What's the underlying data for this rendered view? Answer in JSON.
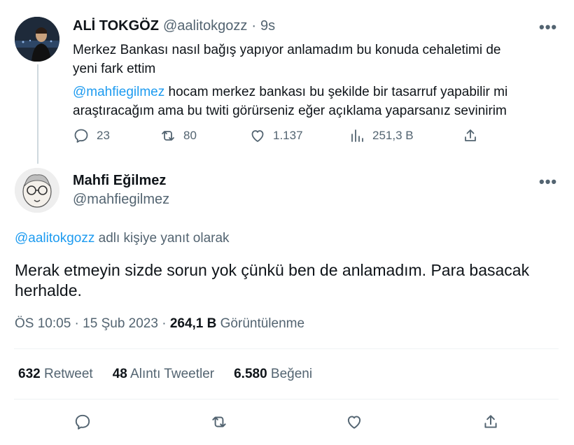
{
  "tweet1": {
    "author_name": "ALİ TOKGÖZ",
    "handle": "@aalitokgozz",
    "separator": "·",
    "time": "9s",
    "line1": "Merkez Bankası nasıl bağış yapıyor anlamadım bu konuda cehaletimi de",
    "line2": "yeni fark ettim",
    "mention": "@mahfiegilmez",
    "line3_rest": " hocam merkez bankası bu şekilde bir tasarruf yapabilir mi",
    "line4": "araştıracağım ama bu twiti görürseniz eğer açıklama yaparsanız sevinirim",
    "actions": {
      "replies": "23",
      "retweets": "80",
      "likes": "1.137",
      "views": "251,3 B"
    }
  },
  "tweet2": {
    "author_name": "Mahfi Eğilmez",
    "handle": "@mahfiegilmez",
    "reply_to_mention": "@aalitokgozz",
    "reply_to_text": " adlı kişiye yanıt olarak",
    "text_line1": "Merak etmeyin sizde sorun yok çünkü ben de anlamadım. Para basacak",
    "text_line2": "herhalde.",
    "timestamp": "ÖS 10:05 · 15 Şub 2023",
    "dot": " · ",
    "views_count": "264,1 B",
    "views_label": " Görüntülenme",
    "stats": {
      "retweets_count": "632",
      "retweets_label": " Retweet",
      "quotes_count": "48",
      "quotes_label": " Alıntı Tweetler",
      "likes_count": "6.580",
      "likes_label": " Beğeni"
    }
  },
  "more_label": "•••",
  "colors": {
    "text": "#0f1419",
    "muted": "#536471",
    "link": "#1d9bf0",
    "divider": "#eff3f4"
  }
}
